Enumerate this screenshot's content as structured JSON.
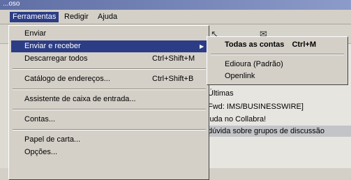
{
  "window": {
    "title": "...oso"
  },
  "menubar": {
    "items": [
      {
        "label": "Ferramentas"
      },
      {
        "label": "Redigir"
      },
      {
        "label": "Ajuda"
      }
    ]
  },
  "toolbar": {
    "icons": [
      "envelope-icon",
      "cursor-icon"
    ]
  },
  "menu": {
    "enviar": "Enviar",
    "enviar_receber": "Enviar e receber",
    "descarregar": "Descarregar todos",
    "descarregar_shortcut": "Ctrl+Shift+M",
    "catalogo": "Catálogo de endereços...",
    "catalogo_shortcut": "Ctrl+Shift+B",
    "assistente": "Assistente de caixa de entrada...",
    "contas": "Contas...",
    "papel": "Papel de carta...",
    "opcoes": "Opções..."
  },
  "submenu": {
    "todas": "Todas as contas",
    "todas_shortcut": "Ctrl+M",
    "edioura": "Edioura (Padrão)",
    "openlink": "Openlink"
  },
  "messages": [
    "Últimas",
    "Fwd: IMS/BUSINESSWIRE]",
    "juda no Collabra!",
    "dúvida sobre grupos de discussão"
  ],
  "colors": {
    "menu_highlight": "#2c3d86",
    "menu_background": "#d4d0c8"
  }
}
